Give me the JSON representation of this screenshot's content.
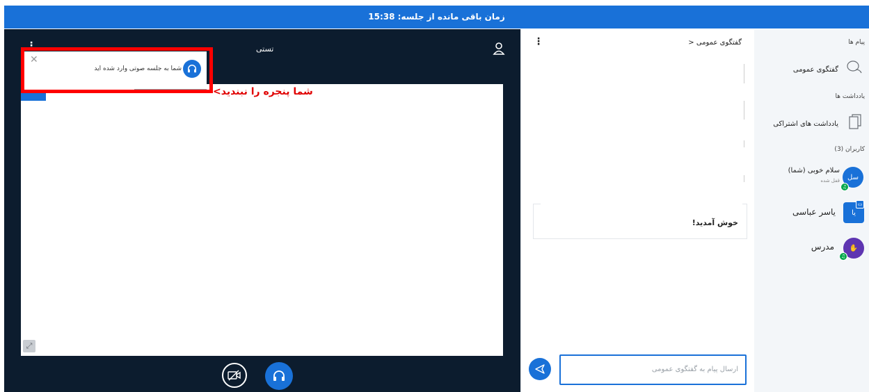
{
  "topbar": {
    "time_remaining": "زمان باقی مانده از جلسه: 15:38"
  },
  "presentation": {
    "title": "تستی",
    "toast_text": "شما به جلسه صوتی وارد شده اید",
    "annotation": "شما پنجره را نبندید>"
  },
  "chat": {
    "title": "گفتگوی عمومی",
    "back_glyph": "<",
    "welcome": "خوش آمدید!",
    "input_placeholder": "ارسال پیام به گفتگوی عمومی"
  },
  "sidebar": {
    "messages_title": "پیام ها",
    "public_chat": "گفتگوی عمومی",
    "notes_title": "یادداشت ها",
    "shared_notes": "یادداشت های اشتراکی",
    "users_title": "کاربران (3)",
    "users": [
      {
        "name": "سلام خوبی (شما)",
        "initials": "سل",
        "status": "قفل شده",
        "color": "#1971d8"
      },
      {
        "name": "یاسر عباسی",
        "initials": "یا",
        "status": "",
        "color": "#1971d8"
      },
      {
        "name": "مدرس",
        "initials": "",
        "status": "",
        "color": "#5e35b1"
      }
    ]
  },
  "colors": {
    "primary": "#1971d8",
    "stage_bg": "#0c1c2e",
    "annotation_red": "#ff0000"
  }
}
